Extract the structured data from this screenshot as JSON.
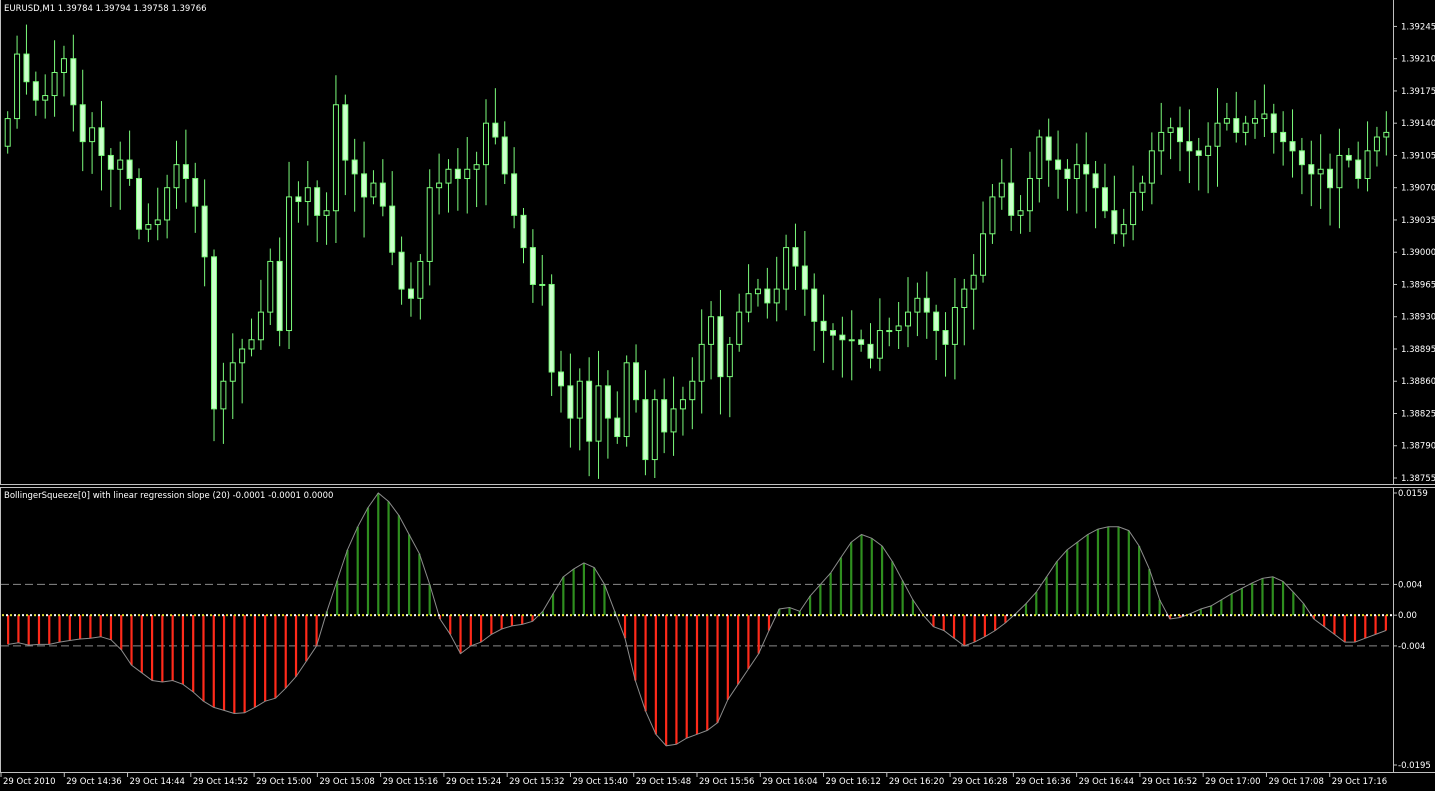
{
  "header": {
    "title": "EURUSD,M1  1.39784 1.39794 1.39758 1.39766",
    "indicator_title": "BollingerSqueeze[0] with linear regression slope (20) -0.0001 -0.0001 0.0000"
  },
  "colors": {
    "background": "#000000",
    "candle": "#7cfc7c",
    "candle_body": "#ccffcc",
    "hist_positive": "#2f8f1f",
    "hist_negative": "#ff2a1a",
    "slope_line": "#8c8c8c",
    "squeeze_dots_a": "#e6e63a",
    "squeeze_dots_b": "#ffffff",
    "grid_dash": "#8a8a8a",
    "panel_border": "#c0c0c0"
  },
  "chart_data": [
    {
      "type": "candlestick",
      "title": "EURUSD,M1  1.39784 1.39794 1.39758 1.39766",
      "symbol": "EURUSD",
      "timeframe": "M1",
      "ohlc_readout": [
        1.39784,
        1.39794,
        1.39758,
        1.39766
      ],
      "ylim": [
        1.38755,
        1.39265
      ],
      "y_ticks": [
        "1.39245",
        "1.39210",
        "1.39175",
        "1.39140",
        "1.39105",
        "1.39070",
        "1.39035",
        "1.39000",
        "1.38965",
        "1.38930",
        "1.38895",
        "1.38860",
        "1.38825",
        "1.38790",
        "1.38755"
      ],
      "closes": [
        1.39145,
        1.39215,
        1.39185,
        1.39165,
        1.3917,
        1.39195,
        1.3921,
        1.3916,
        1.3912,
        1.39135,
        1.39105,
        1.3909,
        1.391,
        1.3908,
        1.39025,
        1.3903,
        1.39035,
        1.3907,
        1.39095,
        1.3908,
        1.3905,
        1.38995,
        1.3883,
        1.3886,
        1.3888,
        1.38895,
        1.38905,
        1.38935,
        1.3899,
        1.38915,
        1.3906,
        1.39055,
        1.3907,
        1.3904,
        1.39045,
        1.3916,
        1.391,
        1.39085,
        1.3906,
        1.39075,
        1.3905,
        1.39,
        1.3896,
        1.3895,
        1.3899,
        1.3907,
        1.39075,
        1.3909,
        1.3908,
        1.3909,
        1.39095,
        1.3914,
        1.39125,
        1.39085,
        1.3904,
        1.39005,
        1.38965,
        1.38965,
        1.3887,
        1.38855,
        1.3882,
        1.3886,
        1.38795,
        1.38855,
        1.3882,
        1.388,
        1.3888,
        1.3884,
        1.38775,
        1.3884,
        1.38805,
        1.3883,
        1.3884,
        1.3886,
        1.389,
        1.3893,
        1.38865,
        1.389,
        1.38935,
        1.38955,
        1.3896,
        1.38945,
        1.3896,
        1.39005,
        1.38985,
        1.3896,
        1.38925,
        1.38915,
        1.3891,
        1.38905,
        1.38905,
        1.389,
        1.38885,
        1.38915,
        1.38915,
        1.3892,
        1.38935,
        1.3895,
        1.38935,
        1.38915,
        1.389,
        1.3894,
        1.3896,
        1.38975,
        1.3902,
        1.3906,
        1.39075,
        1.3904,
        1.39045,
        1.3908,
        1.39125,
        1.391,
        1.3909,
        1.3908,
        1.39095,
        1.39085,
        1.3907,
        1.39045,
        1.3902,
        1.3903,
        1.39065,
        1.39075,
        1.3911,
        1.3913,
        1.39135,
        1.3912,
        1.3911,
        1.39105,
        1.39115,
        1.3914,
        1.39145,
        1.3913,
        1.3914,
        1.39145,
        1.3915,
        1.3913,
        1.3912,
        1.3911,
        1.39095,
        1.39085,
        1.3909,
        1.3907,
        1.39105,
        1.391,
        1.3908,
        1.3911,
        1.39125,
        1.3913
      ]
    },
    {
      "type": "bar",
      "title": "BollingerSqueeze[0] with linear regression slope (20) -0.0001 -0.0001 0.0000",
      "indicator": "BollingerSqueeze[0]",
      "description": "with linear regression slope (20)",
      "readout": [
        -0.0001,
        -0.0001,
        0.0
      ],
      "ylim": [
        -0.0195,
        0.0159
      ],
      "y_ticks": [
        "0.0159",
        "0.004",
        "0.00",
        "-0.004",
        "-0.0195"
      ],
      "levels": [
        0.004,
        0.0,
        -0.004
      ],
      "values": [
        -0.0038,
        -0.0036,
        -0.0039,
        -0.0038,
        -0.0038,
        -0.0035,
        -0.0033,
        -0.0031,
        -0.003,
        -0.0028,
        -0.0032,
        -0.0045,
        -0.0065,
        -0.0075,
        -0.0085,
        -0.0087,
        -0.0085,
        -0.009,
        -0.01,
        -0.0112,
        -0.012,
        -0.0124,
        -0.0128,
        -0.0127,
        -0.012,
        -0.0112,
        -0.0108,
        -0.0095,
        -0.008,
        -0.006,
        -0.004,
        0.0005,
        0.0045,
        0.0085,
        0.0115,
        0.014,
        0.0159,
        0.0148,
        0.013,
        0.0105,
        0.008,
        0.004,
        -0.0005,
        -0.0025,
        -0.005,
        -0.004,
        -0.0035,
        -0.0025,
        -0.0018,
        -0.0014,
        -0.0012,
        -0.0008,
        0.0005,
        0.0028,
        0.005,
        0.006,
        0.0068,
        0.0062,
        0.004,
        0.0005,
        -0.003,
        -0.0085,
        -0.0125,
        -0.0155,
        -0.017,
        -0.0168,
        -0.016,
        -0.0155,
        -0.015,
        -0.014,
        -0.011,
        -0.009,
        -0.007,
        -0.005,
        -0.002,
        0.0008,
        0.001,
        0.0005,
        0.0025,
        0.004,
        0.0055,
        0.0075,
        0.0095,
        0.0105,
        0.01,
        0.009,
        0.007,
        0.0045,
        0.002,
        0.0,
        -0.0015,
        -0.002,
        -0.003,
        -0.004,
        -0.0035,
        -0.0028,
        -0.002,
        -0.001,
        0.0002,
        0.0015,
        0.003,
        0.005,
        0.007,
        0.0085,
        0.0095,
        0.0105,
        0.0112,
        0.0115,
        0.0115,
        0.011,
        0.009,
        0.006,
        0.002,
        -0.0005,
        -0.0003,
        0.0002,
        0.0008,
        0.0012,
        0.002,
        0.0028,
        0.0035,
        0.0042,
        0.0048,
        0.005,
        0.0044,
        0.003,
        0.0015,
        -0.0005,
        -0.0015,
        -0.0025,
        -0.0035,
        -0.0035,
        -0.003,
        -0.0025,
        -0.002
      ]
    }
  ],
  "x_axis": {
    "labels": [
      "29 Oct 2010",
      "29 Oct 14:36",
      "29 Oct 14:44",
      "29 Oct 14:52",
      "29 Oct 15:00",
      "29 Oct 15:08",
      "29 Oct 15:16",
      "29 Oct 15:24",
      "29 Oct 15:32",
      "29 Oct 15:40",
      "29 Oct 15:48",
      "29 Oct 15:56",
      "29 Oct 16:04",
      "29 Oct 16:12",
      "29 Oct 16:20",
      "29 Oct 16:28",
      "29 Oct 16:36",
      "29 Oct 16:44",
      "29 Oct 16:52",
      "29 Oct 17:00",
      "29 Oct 17:08",
      "29 Oct 17:16"
    ]
  }
}
